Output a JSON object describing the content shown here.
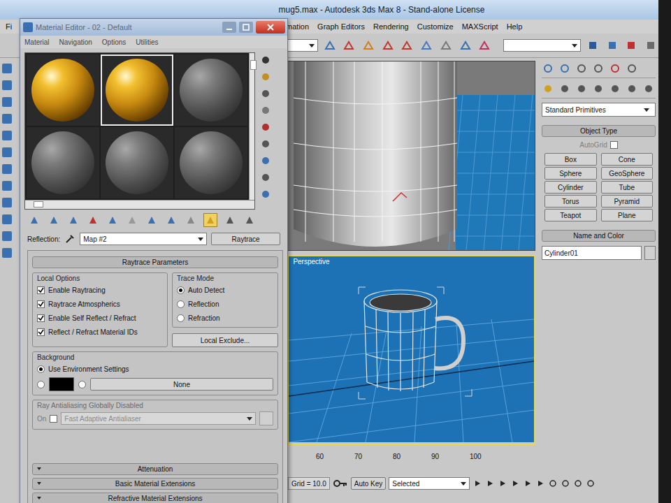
{
  "app": {
    "title": "mug5.max - Autodesk 3ds Max 8 - Stand-alone License",
    "menu": [
      "Fi",
      "Animation",
      "Graph Editors",
      "Rendering",
      "Customize",
      "MAXScript",
      "Help"
    ]
  },
  "material_editor": {
    "title": "Material Editor - 02 - Default",
    "menu": [
      "Material",
      "Navigation",
      "Options",
      "Utilities"
    ],
    "slots": [
      {
        "kind": "gold",
        "selected": false
      },
      {
        "kind": "gold",
        "selected": true
      },
      {
        "kind": "grey",
        "selected": false
      },
      {
        "kind": "grey",
        "selected": false
      },
      {
        "kind": "grey",
        "selected": false
      },
      {
        "kind": "grey",
        "selected": false
      }
    ],
    "map_label": "Reflection:",
    "map_name": "Map #2",
    "map_type": "Raytrace",
    "rollout": "Raytrace Parameters",
    "local_options": {
      "title": "Local Options",
      "items": [
        {
          "label": "Enable Raytracing",
          "checked": true
        },
        {
          "label": "Raytrace Atmospherics",
          "checked": true
        },
        {
          "label": "Enable Self Reflect / Refract",
          "checked": true
        },
        {
          "label": "Reflect / Refract Material IDs",
          "checked": true
        }
      ]
    },
    "trace_mode": {
      "title": "Trace Mode",
      "options": [
        {
          "label": "Auto Detect",
          "selected": true
        },
        {
          "label": "Reflection",
          "selected": false
        },
        {
          "label": "Refraction",
          "selected": false
        }
      ]
    },
    "local_exclude": "Local Exclude...",
    "background": {
      "title": "Background",
      "options": [
        {
          "kind": "text",
          "label": "Use Environment Settings",
          "selected": true
        },
        {
          "kind": "swatch",
          "color": "#000000",
          "selected": false
        },
        {
          "kind": "button",
          "label": "None",
          "selected": false
        }
      ]
    },
    "antialiasing": {
      "title": "Ray Antialiasing Globally Disabled",
      "on_label": "On",
      "on_checked": false,
      "setting": "Fast Adaptive Antialiaser",
      "disabled": true
    },
    "collapsed_rollouts": [
      "Attenuation",
      "Basic Material Extensions",
      "Refractive Material Extensions"
    ]
  },
  "viewports": {
    "perspective_label": "Perspective",
    "perspective_active": true
  },
  "command_panel": {
    "category": "Standard Primitives",
    "object_type": "Object Type",
    "autogrid": {
      "label": "AutoGrid",
      "checked": false,
      "disabled": true
    },
    "buttons": [
      "Box",
      "Cone",
      "Sphere",
      "GeoSphere",
      "Cylinder",
      "Tube",
      "Torus",
      "Pyramid",
      "Teapot",
      "Plane"
    ],
    "name_and_color": "Name and Color",
    "object_name": "Cylinder01"
  },
  "timeline": {
    "ticks": [
      "60",
      "70",
      "80",
      "90",
      "100"
    ],
    "grid": "Grid = 10.0",
    "auto_key": "Auto Key",
    "key_filter": "Selected"
  }
}
